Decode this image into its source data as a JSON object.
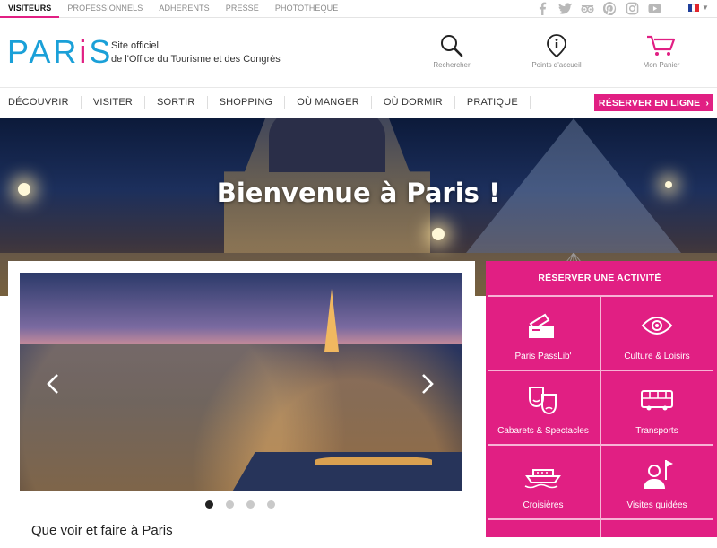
{
  "topbar": {
    "tabs": [
      "VISITEURS",
      "PROFESSIONNELS",
      "ADHÉRENTS",
      "PRESSE",
      "PHOTOTHÈQUE"
    ],
    "active_tab": "VISITEURS",
    "socials": [
      "facebook-icon",
      "twitter-icon",
      "tripadvisor-icon",
      "pinterest-icon",
      "instagram-icon",
      "youtube-icon"
    ],
    "language_flag_colors": [
      "#1f3f9b",
      "#ffffff",
      "#e1262d"
    ]
  },
  "header": {
    "logo": "PARiS",
    "tagline_line1": "Site officiel",
    "tagline_line2": "de l'Office du Tourisme et des Congrès",
    "search_label": "Rechercher",
    "points_label": "Points d'accueil",
    "cart_label": "Mon Panier"
  },
  "nav": {
    "items": [
      "DÉCOUVRIR",
      "VISITER",
      "SORTIR",
      "SHOPPING",
      "OÙ MANGER",
      "OÙ DORMIR",
      "PRATIQUE"
    ],
    "reserve_button": "RÉSERVER EN LIGNE"
  },
  "hero": {
    "title": "Bienvenue à Paris !"
  },
  "carousel": {
    "slide_count": 4,
    "active_slide": 1,
    "caption": "Que voir et faire à Paris"
  },
  "activities": {
    "title": "RÉSERVER UNE ACTIVITÉ",
    "tiles": [
      {
        "label": "Paris PassLib'",
        "icon": "pass-ticket-icon"
      },
      {
        "label": "Culture & Loisirs",
        "icon": "eye-icon"
      },
      {
        "label": "Cabarets & Spectacles",
        "icon": "theatre-masks-icon"
      },
      {
        "label": "Transports",
        "icon": "bus-icon"
      },
      {
        "label": "Croisières",
        "icon": "boat-icon"
      },
      {
        "label": "Visites guidées",
        "icon": "guide-flag-icon"
      }
    ]
  },
  "colors": {
    "brand_blue": "#1aa0d8",
    "brand_pink": "#e11f83"
  }
}
